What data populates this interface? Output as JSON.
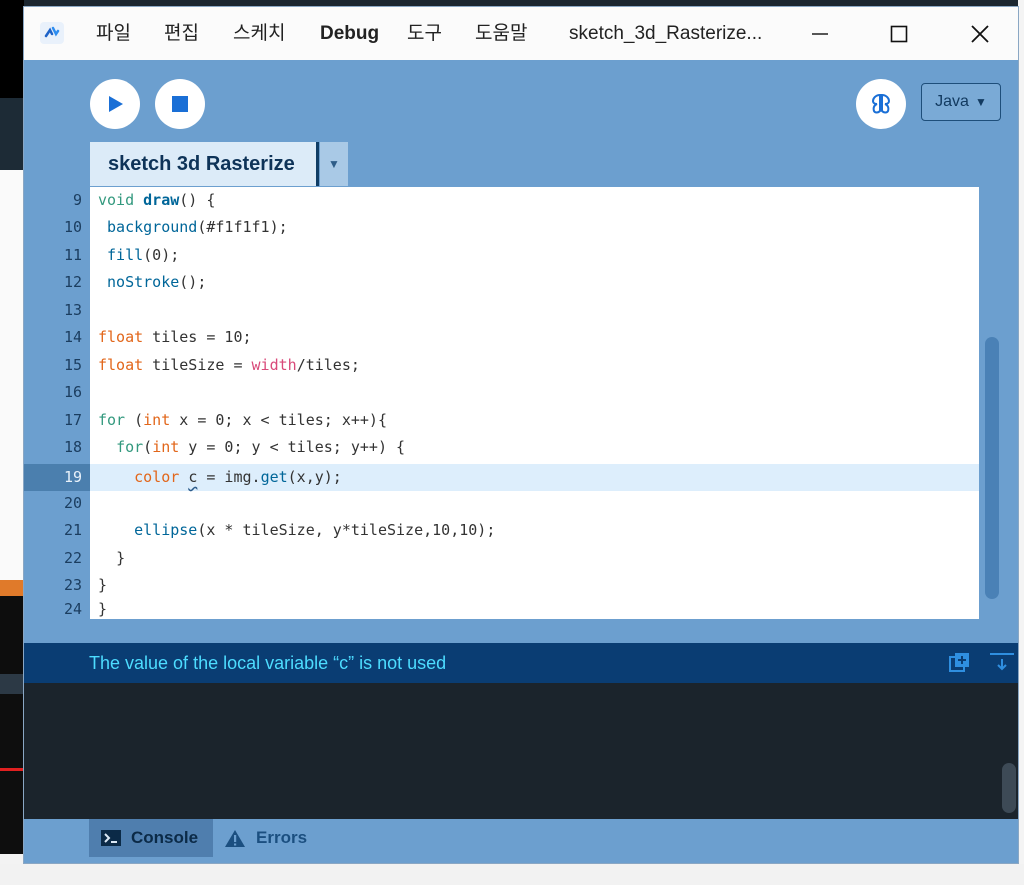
{
  "window": {
    "title": "sketch_3d_Rasterize...",
    "menu": [
      "파일",
      "편집",
      "스케치",
      "Debug",
      "도구",
      "도움말"
    ]
  },
  "toolbar": {
    "mode": "Java",
    "mode_arrow": "▼"
  },
  "tab": {
    "name": "sketch 3d Rasterize",
    "menu_arrow": "▼"
  },
  "editor": {
    "active_line": 19,
    "lines": [
      {
        "n": "9"
      },
      {
        "n": "10"
      },
      {
        "n": "11"
      },
      {
        "n": "12"
      },
      {
        "n": "13"
      },
      {
        "n": "14"
      },
      {
        "n": "15"
      },
      {
        "n": "16"
      },
      {
        "n": "17"
      },
      {
        "n": "18"
      },
      {
        "n": "19"
      },
      {
        "n": "20"
      },
      {
        "n": "21"
      },
      {
        "n": "22"
      },
      {
        "n": "23"
      },
      {
        "n": "24"
      }
    ],
    "code": {
      "l9_kw": "void",
      "l9_fn": "draw",
      "l9_rest": "() {",
      "l10_fn": "background",
      "l10_rest": "(#f1f1f1);",
      "l11_fn": "fill",
      "l11_rest": "(0);",
      "l12_fn": "noStroke",
      "l12_rest": "();",
      "l14_kw": "float",
      "l14_rest": " tiles = 10;",
      "l15_kw": "float",
      "l15_rest": " tileSize = ",
      "l15_pk": "width",
      "l15_rest2": "/tiles;",
      "l17_kw": "for",
      "l17_a": " (",
      "l17_kw2": "int",
      "l17_rest": " x = 0; x < tiles; x++){",
      "l18_kw": "for",
      "l18_a": "(",
      "l18_kw2": "int",
      "l18_rest": " y = 0; y < tiles; y++) {",
      "l19_kw": "color",
      "l19_var": "c",
      "l19_a": " = img.",
      "l19_fn": "get",
      "l19_rest": "(x,y);",
      "l21_fn": "ellipse",
      "l21_rest": "(x * tileSize, y*tileSize,10,10);",
      "l22": "}",
      "l23": "}",
      "l24": "}"
    }
  },
  "status": {
    "message": "The value of the local variable “c” is not used"
  },
  "footer": {
    "console_label": "Console",
    "errors_label": "Errors"
  }
}
